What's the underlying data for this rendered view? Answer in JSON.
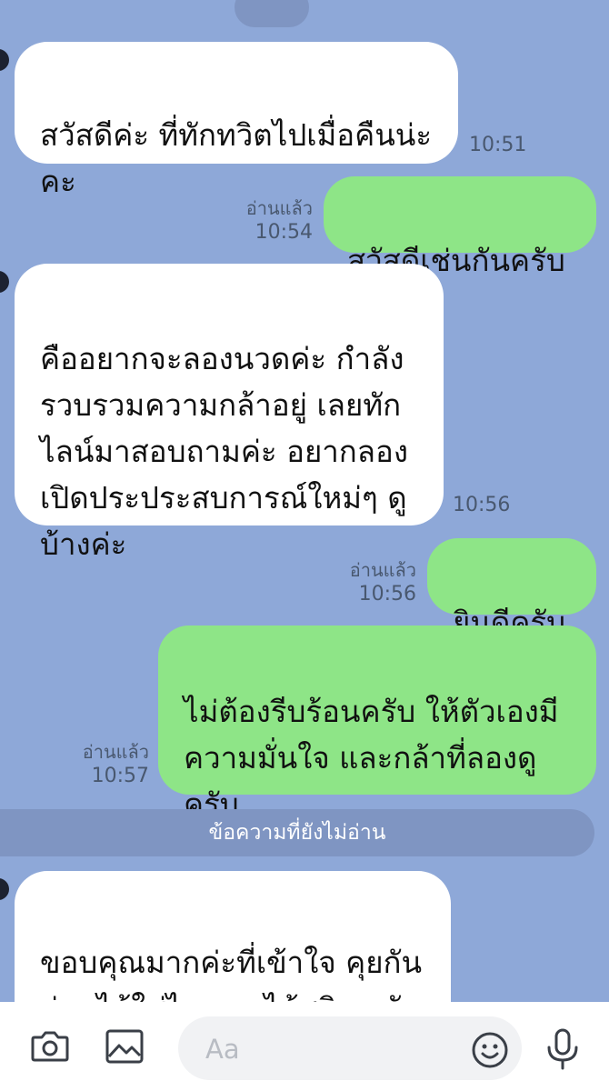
{
  "messages": [
    {
      "direction": "in",
      "text": "สวัสดีค่ะ ที่ทักทวิตไปเมื่อคืนน่ะ\nคะ",
      "time": "10:51"
    },
    {
      "direction": "out",
      "text": "สวัสดีเช่นกันครับ",
      "read": "อ่านแล้ว",
      "time": "10:54"
    },
    {
      "direction": "in",
      "text": "คืออยากจะลองนวดค่ะ กำลัง\nรวบรวมความกล้าอยู่ เลยทัก\nไลน์มาสอบถามค่ะ อยากลอง\nเปิดประประสบการณ์ใหม่ๆ ดู\nบ้างค่ะ",
      "time": "10:56"
    },
    {
      "direction": "out",
      "text": "ยินดีครับ",
      "read": "อ่านแล้ว",
      "time": "10:56"
    },
    {
      "direction": "out",
      "text": "ไม่ต้องรีบร้อนครับ  ให้ตัวเองมี\nความมั่นใจ และกล้าที่ลองดู\nครับ",
      "read": "อ่านแล้ว",
      "time": "10:57"
    },
    {
      "direction": "in",
      "text": "ขอบคุณมากค่ะที่เข้าใจ คุยกัน\nก่อนได้ใช่ไหม จะได้สนิทๆ กัน\nหน่อย ได้มั่นใจขึ้นนนน"
    }
  ],
  "unread_divider": "ข้อความที่ยังไม่อ่าน",
  "composer": {
    "placeholder": "Aa",
    "icons": [
      "camera-icon",
      "image-icon",
      "emoji-icon",
      "microphone-icon"
    ]
  },
  "colors": {
    "background": "#8ea8d8",
    "incoming_bubble": "#ffffff",
    "outgoing_bubble": "#8ee587",
    "divider": "#7f95c2",
    "meta_text": "#49586f"
  }
}
